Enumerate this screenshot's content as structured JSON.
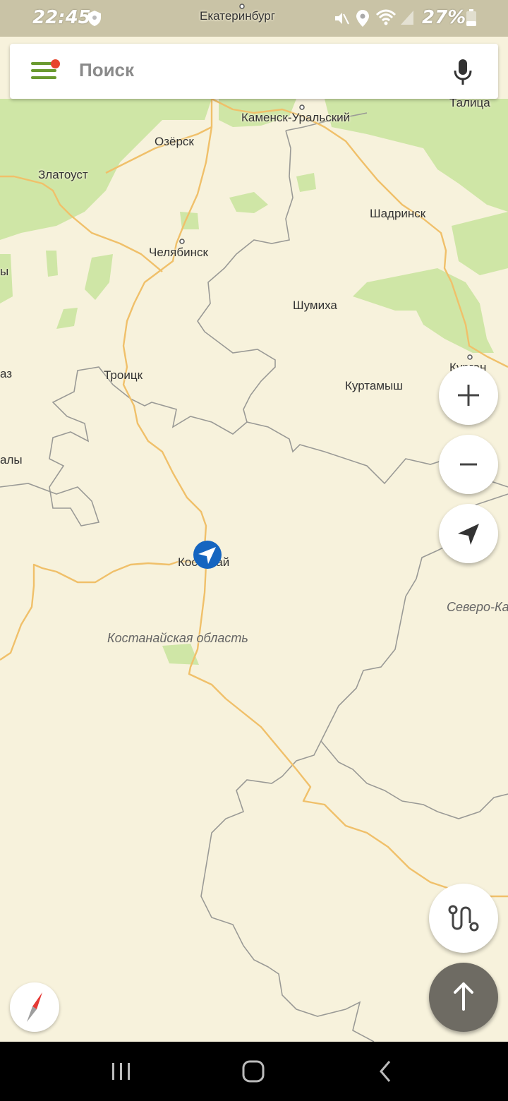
{
  "status_bar": {
    "time": "22:45",
    "battery": "27%"
  },
  "search": {
    "placeholder": "Поиск"
  },
  "map": {
    "cities": {
      "ekaterinburg": "Екатеринбург",
      "kamensk": "Каменск-Уральский",
      "talitsa": "Талица",
      "ozersk": "Озёрск",
      "zlatoust": "Златоуст",
      "shadrinsk": "Шадринск",
      "chelyabinsk": "Челябинск",
      "shumikha": "Шумиха",
      "kurgan": "Курган",
      "troitsk": "Троицк",
      "kurtamysh": "Куртамыш",
      "kostanay": "Костанай",
      "edge1": "ы",
      "edge2": "аз",
      "edge3": "алы"
    },
    "regions": {
      "kostanay_oblast": "Костанайская область",
      "north_kz": "Северо-Ка"
    }
  },
  "colors": {
    "land": "#f7f2dc",
    "forest": "#cfe6a6",
    "road": "#f0c06a",
    "border": "#8e8e8e",
    "accent": "#6a9a2f",
    "location": "#1565c0"
  },
  "controls": {
    "zoom_in": "plus-icon",
    "zoom_out": "minus-icon",
    "my_location": "navigation-arrow-icon",
    "routes": "route-icon",
    "compass": "compass-icon",
    "navigate": "arrow-up-icon"
  }
}
